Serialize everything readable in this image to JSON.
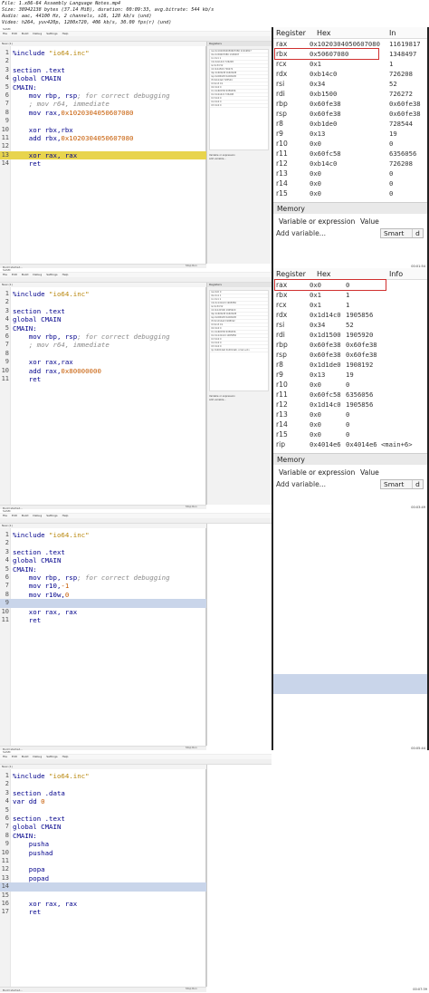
{
  "header": {
    "line1": "File: 1.x86-64 Assembly Language Notes.mp4",
    "line2": "Size: 38942138 bytes (37.14 MiB), duration: 00:09:33, avg.bitrate: 544 kb/s",
    "line3": "Audio: aac, 44100 Hz, 2 channels, s16, 128 kb/s (und)",
    "line4": "Video: h264, yuv420p, 1280x720, 406 kb/s, 30.00 fps(r) (und)"
  },
  "ide": {
    "title": "SASM",
    "menu": [
      "File",
      "Edit",
      "Build",
      "Debug",
      "Settings",
      "Help"
    ],
    "tab": "New (1)",
    "register_panel_title": "Registers",
    "memory_label": "Memory",
    "variable_label": "Variable or expression",
    "add_variable": "Add variable...",
    "status": "Build started...",
    "window_buttons": "Stop  Run"
  },
  "frames": [
    {
      "code": [
        {
          "n": "1",
          "t": "%include \"io64.inc\""
        },
        {
          "n": "2",
          "t": ""
        },
        {
          "n": "3",
          "t": "section .text"
        },
        {
          "n": "4",
          "t": "global CMAIN"
        },
        {
          "n": "5",
          "t": "CMAIN:"
        },
        {
          "n": "6",
          "t": "    mov rbp, rsp; for correct debugging"
        },
        {
          "n": "7",
          "t": "    ; mov r64, immediate"
        },
        {
          "n": "8",
          "t": "    mov rax,0x1020304050607080"
        },
        {
          "n": "9",
          "t": ""
        },
        {
          "n": "10",
          "t": "    xor rbx,rbx"
        },
        {
          "n": "11",
          "t": "    add rbx,0x1020304050607080"
        },
        {
          "n": "12",
          "t": ""
        },
        {
          "n": "13",
          "t": "    xor rax, rax"
        },
        {
          "n": "14",
          "t": "    ret"
        }
      ],
      "highlight_line": 13,
      "registers": {
        "headers": [
          "Register",
          "Hex",
          "In"
        ],
        "rows": [
          [
            "rax",
            "0x1020304050607080",
            "11619817"
          ],
          [
            "rbx",
            "0x50607080",
            "1348497"
          ],
          [
            "rcx",
            "0x1",
            "1"
          ],
          [
            "rdx",
            "0xb14c0",
            "726208"
          ],
          [
            "rsi",
            "0x34",
            "52"
          ],
          [
            "rdi",
            "0xb1500",
            "726272"
          ],
          [
            "rbp",
            "0x60fe38",
            "0x60fe38"
          ],
          [
            "rsp",
            "0x60fe38",
            "0x60fe38"
          ],
          [
            "r8",
            "0xb1de0",
            "728544"
          ],
          [
            "r9",
            "0x13",
            "19"
          ],
          [
            "r10",
            "0x0",
            "0"
          ],
          [
            "r11",
            "0x60fc58",
            "6356056"
          ],
          [
            "r12",
            "0xb14c0",
            "726208"
          ],
          [
            "r13",
            "0x0",
            "0"
          ],
          [
            "r14",
            "0x0",
            "0"
          ],
          [
            "r15",
            "0x0",
            "0"
          ]
        ],
        "memory": "Memory",
        "col_var": "Variable or expression",
        "col_val": "Value",
        "add": "Add variable...",
        "smart": "Smart",
        "smart_btn": "d"
      },
      "timestamp": "00:01:54"
    },
    {
      "code": [
        {
          "n": "1",
          "t": "%include \"io64.inc\""
        },
        {
          "n": "2",
          "t": ""
        },
        {
          "n": "3",
          "t": "section .text"
        },
        {
          "n": "4",
          "t": "global CMAIN"
        },
        {
          "n": "5",
          "t": "CMAIN:"
        },
        {
          "n": "6",
          "t": "    mov rbp, rsp; for correct debugging"
        },
        {
          "n": "7",
          "t": "    ; mov r64, immediate"
        },
        {
          "n": "8",
          "t": ""
        },
        {
          "n": "9",
          "t": "    xor rax,rax"
        },
        {
          "n": "10",
          "t": "    add rax,0x80000000"
        },
        {
          "n": "11",
          "t": "    ret"
        }
      ],
      "highlight_line": 0,
      "registers": {
        "headers": [
          "Register",
          "Hex",
          "Info"
        ],
        "rows": [
          [
            "rax",
            "0x0",
            "0"
          ],
          [
            "rbx",
            "0x1",
            "1"
          ],
          [
            "rcx",
            "0x1",
            "1"
          ],
          [
            "rdx",
            "0x1d14c0",
            "1905856"
          ],
          [
            "rsi",
            "0x34",
            "52"
          ],
          [
            "rdi",
            "0x1d1500",
            "1905920"
          ],
          [
            "rbp",
            "0x60fe38",
            "0x60fe38"
          ],
          [
            "rsp",
            "0x60fe38",
            "0x60fe38"
          ],
          [
            "r8",
            "0x1d1de0",
            "1908192"
          ],
          [
            "r9",
            "0x13",
            "19"
          ],
          [
            "r10",
            "0x0",
            "0"
          ],
          [
            "r11",
            "0x60fc58",
            "6356056"
          ],
          [
            "r12",
            "0x1d14c0",
            "1905856"
          ],
          [
            "r13",
            "0x0",
            "0"
          ],
          [
            "r14",
            "0x0",
            "0"
          ],
          [
            "r15",
            "0x0",
            "0"
          ],
          [
            "rip",
            "0x4014e6",
            "0x4014e6 <main+6>"
          ]
        ],
        "memory": "Memory",
        "col_var": "Variable or expression",
        "col_val": "Value",
        "add": "Add variable...",
        "smart": "Smart",
        "smart_btn": "d"
      },
      "timestamp": "00:03:49"
    },
    {
      "code": [
        {
          "n": "1",
          "t": "%include \"io64.inc\""
        },
        {
          "n": "2",
          "t": ""
        },
        {
          "n": "3",
          "t": "section .text"
        },
        {
          "n": "4",
          "t": "global CMAIN"
        },
        {
          "n": "5",
          "t": "CMAIN:"
        },
        {
          "n": "6",
          "t": "    mov rbp, rsp; for correct debugging"
        },
        {
          "n": "7",
          "t": "    mov r10,-1"
        },
        {
          "n": "8",
          "t": "    mov r10w,0"
        },
        {
          "n": "9",
          "t": ""
        },
        {
          "n": "10",
          "t": "    xor rax, rax"
        },
        {
          "n": "11",
          "t": "    ret"
        }
      ],
      "highlight_line": 9,
      "timestamp": "00:05:44"
    },
    {
      "code": [
        {
          "n": "1",
          "t": "%include \"io64.inc\""
        },
        {
          "n": "2",
          "t": ""
        },
        {
          "n": "3",
          "t": "section .data"
        },
        {
          "n": "4",
          "t": "var dd 0"
        },
        {
          "n": "5",
          "t": ""
        },
        {
          "n": "6",
          "t": "section .text"
        },
        {
          "n": "7",
          "t": "global CMAIN"
        },
        {
          "n": "8",
          "t": "CMAIN:"
        },
        {
          "n": "9",
          "t": "    pusha"
        },
        {
          "n": "10",
          "t": "    pushad"
        },
        {
          "n": "11",
          "t": ""
        },
        {
          "n": "12",
          "t": "    popa"
        },
        {
          "n": "13",
          "t": "    popad"
        },
        {
          "n": "14",
          "t": ""
        },
        {
          "n": "15",
          "t": ""
        },
        {
          "n": "16",
          "t": "    xor rax, rax"
        },
        {
          "n": "17",
          "t": "    ret"
        }
      ],
      "highlight_line": 14,
      "timestamp": "00:07:39"
    }
  ],
  "colors": {
    "highlight_yellow": "#e8d44d",
    "highlight_blue": "#c9d5ea",
    "red_box": "#d0302f",
    "code_text": "#00008b"
  }
}
